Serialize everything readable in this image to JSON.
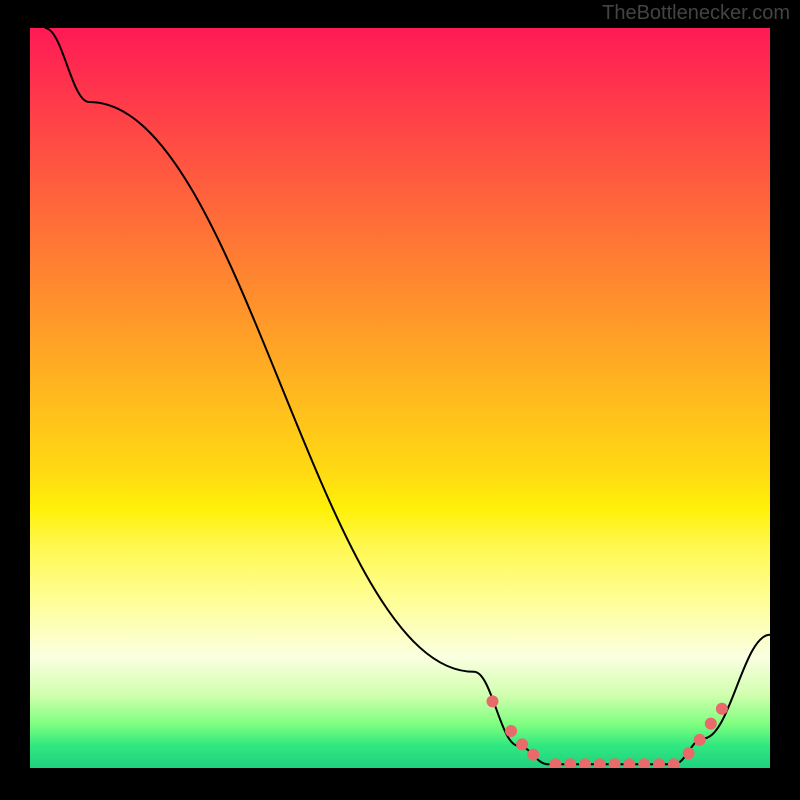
{
  "attribution": "TheBottlenecker.com",
  "chart_data": {
    "type": "line",
    "title": "",
    "xlabel": "",
    "ylabel": "",
    "xlim": [
      0,
      100
    ],
    "ylim": [
      0,
      100
    ],
    "curve": [
      {
        "x": 2,
        "y": 100
      },
      {
        "x": 8,
        "y": 90
      },
      {
        "x": 60,
        "y": 13
      },
      {
        "x": 66,
        "y": 3
      },
      {
        "x": 70,
        "y": 0.5
      },
      {
        "x": 87,
        "y": 0.5
      },
      {
        "x": 91,
        "y": 4
      },
      {
        "x": 100,
        "y": 18
      }
    ],
    "markers": [
      {
        "x": 62.5,
        "y": 9
      },
      {
        "x": 65,
        "y": 5
      },
      {
        "x": 66.5,
        "y": 3.2
      },
      {
        "x": 68,
        "y": 1.8
      },
      {
        "x": 71,
        "y": 0.5
      },
      {
        "x": 73,
        "y": 0.5
      },
      {
        "x": 75,
        "y": 0.5
      },
      {
        "x": 77,
        "y": 0.5
      },
      {
        "x": 79,
        "y": 0.5
      },
      {
        "x": 81,
        "y": 0.5
      },
      {
        "x": 83,
        "y": 0.5
      },
      {
        "x": 85,
        "y": 0.5
      },
      {
        "x": 87,
        "y": 0.5
      },
      {
        "x": 89,
        "y": 2
      },
      {
        "x": 90.5,
        "y": 3.8
      },
      {
        "x": 92,
        "y": 6
      },
      {
        "x": 93.5,
        "y": 8
      }
    ],
    "marker_color": "#e86a6a",
    "line_color": "#000000"
  }
}
